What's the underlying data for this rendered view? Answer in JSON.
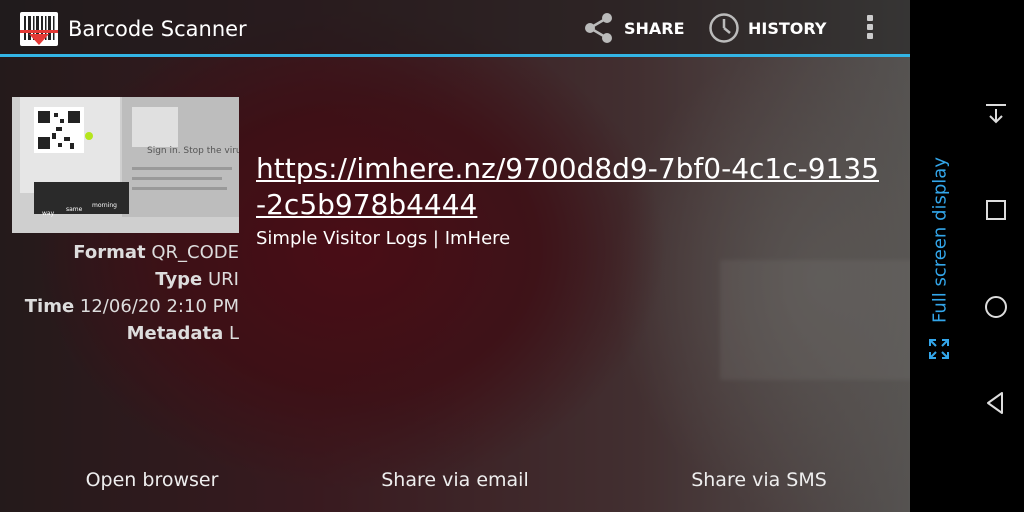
{
  "app": {
    "title": "Barcode Scanner"
  },
  "actionbar": {
    "share_label": "SHARE",
    "history_label": "HISTORY",
    "overflow_icon": "more-vert-icon",
    "accent": "#33b5e5"
  },
  "result": {
    "contents": "https://imhere.nz/9700d8d9-7bf0-4c1c-9135-2c5b978b4444",
    "subtitle": "Simple Visitor Logs | ImHere",
    "meta": [
      {
        "key": "Format",
        "value": "QR_CODE"
      },
      {
        "key": "Type",
        "value": "URI"
      },
      {
        "key": "Time",
        "value": "12/06/20 2:10 PM"
      },
      {
        "key": "Metadata",
        "value": "L"
      }
    ],
    "thumbnail_text": [
      "Sign in. Stop the virus",
      "way",
      "same",
      "morning"
    ]
  },
  "actions": {
    "open_browser": "Open browser",
    "share_email": "Share via email",
    "share_sms": "Share via SMS"
  },
  "navbar": {
    "fullscreen_label": "Full screen display",
    "accent": "#33a6ea"
  }
}
